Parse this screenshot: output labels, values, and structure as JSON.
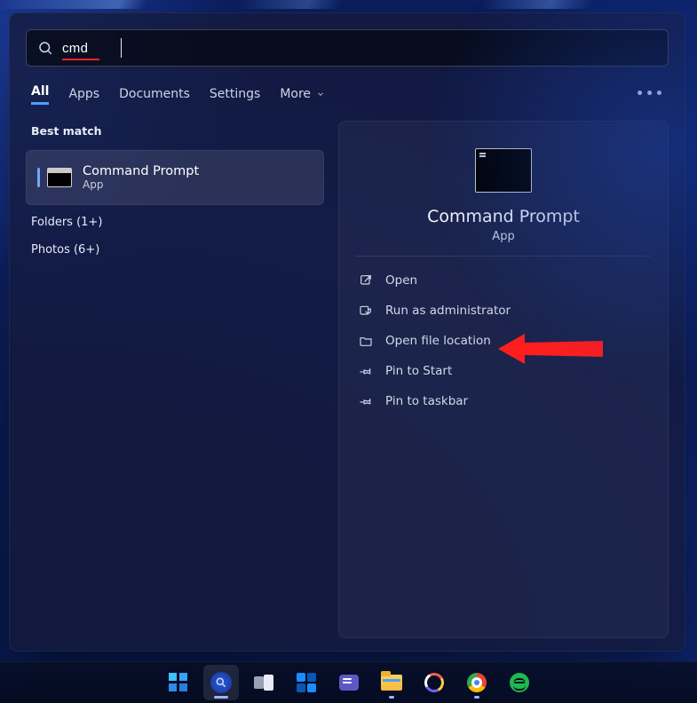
{
  "search": {
    "value": "cmd"
  },
  "tabs": {
    "all": "All",
    "apps": "Apps",
    "documents": "Documents",
    "settings": "Settings",
    "more": "More"
  },
  "left": {
    "best_match_label": "Best match",
    "result": {
      "title": "Command Prompt",
      "subtitle": "App"
    },
    "categories": {
      "folders": "Folders (1+)",
      "photos": "Photos (6+)"
    }
  },
  "right": {
    "title": "Command Prompt",
    "subtitle": "App",
    "actions": {
      "open": "Open",
      "run_admin": "Run as administrator",
      "open_loc": "Open file location",
      "pin_start": "Pin to Start",
      "pin_taskbar": "Pin to taskbar"
    }
  },
  "overflow_label": "…"
}
